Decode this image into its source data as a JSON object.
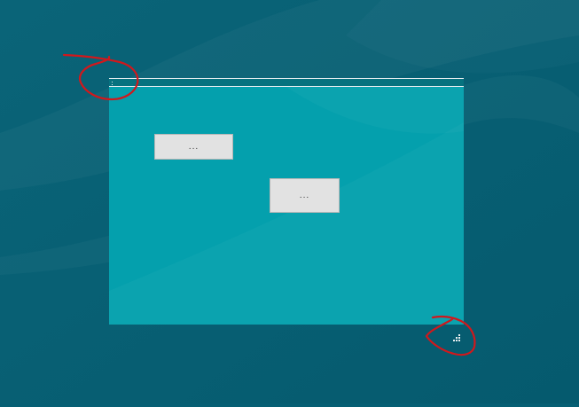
{
  "dialog": {
    "button_1_label": "...",
    "button_2_label": "..."
  },
  "icons": {
    "title_grip": "drag-grip-icon",
    "resize_grip": "resize-grip-icon"
  },
  "colors": {
    "desktop_background": "#065f74",
    "window_client": "#04a0ad",
    "button_face": "#e2e2e2",
    "annotation_stroke": "#d1181c"
  }
}
